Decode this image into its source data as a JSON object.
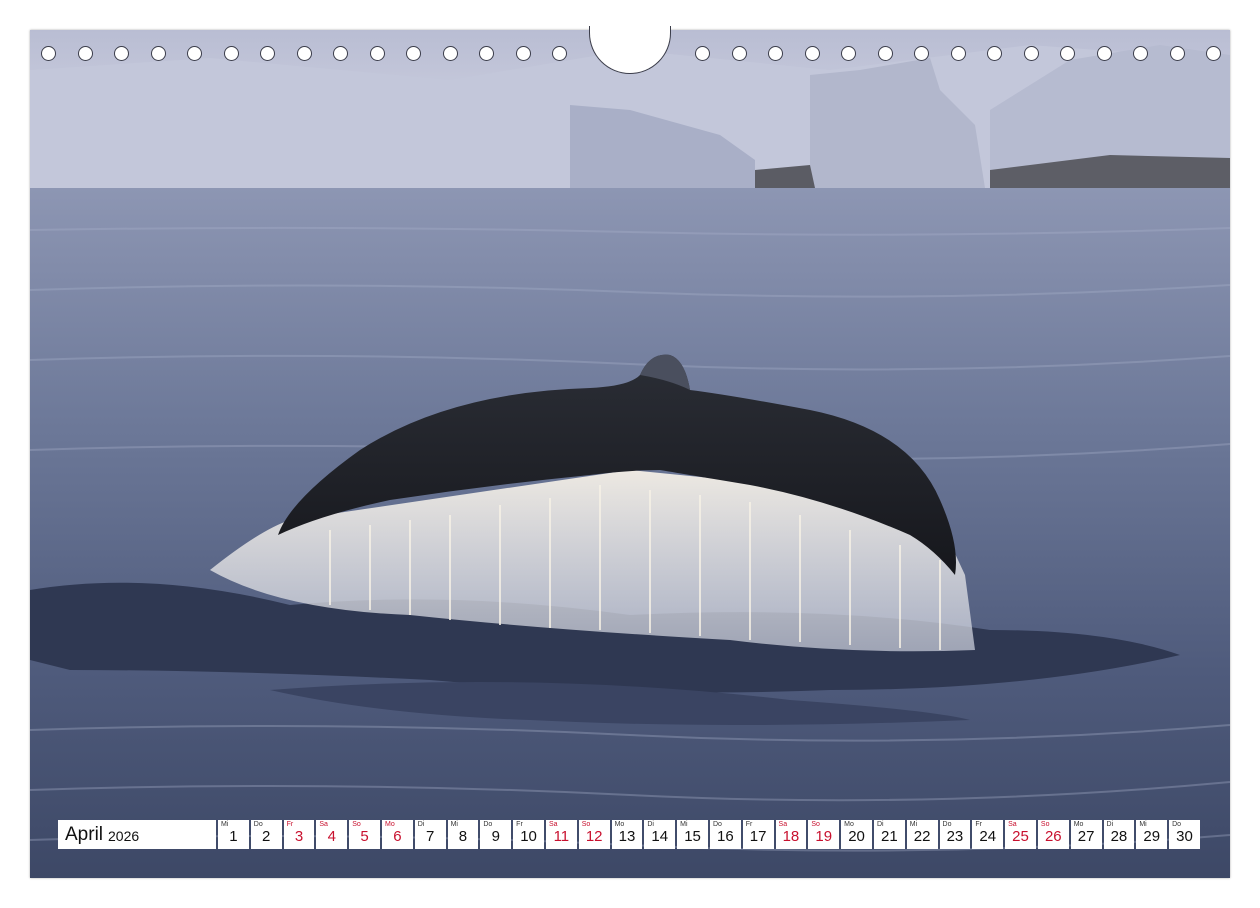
{
  "calendar": {
    "month": "April",
    "year": "2026",
    "days": [
      {
        "dow": "Mi",
        "num": "1",
        "red": false
      },
      {
        "dow": "Do",
        "num": "2",
        "red": false
      },
      {
        "dow": "Fr",
        "num": "3",
        "red": true
      },
      {
        "dow": "Sa",
        "num": "4",
        "red": true
      },
      {
        "dow": "So",
        "num": "5",
        "red": true
      },
      {
        "dow": "Mo",
        "num": "6",
        "red": true
      },
      {
        "dow": "Di",
        "num": "7",
        "red": false
      },
      {
        "dow": "Mi",
        "num": "8",
        "red": false
      },
      {
        "dow": "Do",
        "num": "9",
        "red": false
      },
      {
        "dow": "Fr",
        "num": "10",
        "red": false
      },
      {
        "dow": "Sa",
        "num": "11",
        "red": true
      },
      {
        "dow": "So",
        "num": "12",
        "red": true
      },
      {
        "dow": "Mo",
        "num": "13",
        "red": false
      },
      {
        "dow": "Di",
        "num": "14",
        "red": false
      },
      {
        "dow": "Mi",
        "num": "15",
        "red": false
      },
      {
        "dow": "Do",
        "num": "16",
        "red": false
      },
      {
        "dow": "Fr",
        "num": "17",
        "red": false
      },
      {
        "dow": "Sa",
        "num": "18",
        "red": true
      },
      {
        "dow": "So",
        "num": "19",
        "red": true
      },
      {
        "dow": "Mo",
        "num": "20",
        "red": false
      },
      {
        "dow": "Di",
        "num": "21",
        "red": false
      },
      {
        "dow": "Mi",
        "num": "22",
        "red": false
      },
      {
        "dow": "Do",
        "num": "23",
        "red": false
      },
      {
        "dow": "Fr",
        "num": "24",
        "red": false
      },
      {
        "dow": "Sa",
        "num": "25",
        "red": true
      },
      {
        "dow": "So",
        "num": "26",
        "red": true
      },
      {
        "dow": "Mo",
        "num": "27",
        "red": false
      },
      {
        "dow": "Di",
        "num": "28",
        "red": false
      },
      {
        "dow": "Mi",
        "num": "29",
        "red": false
      },
      {
        "dow": "Do",
        "num": "30",
        "red": false
      }
    ]
  },
  "colors": {
    "red_day": "#c8102e",
    "water": "#5c6a8a",
    "ice": "#c9cde0"
  }
}
